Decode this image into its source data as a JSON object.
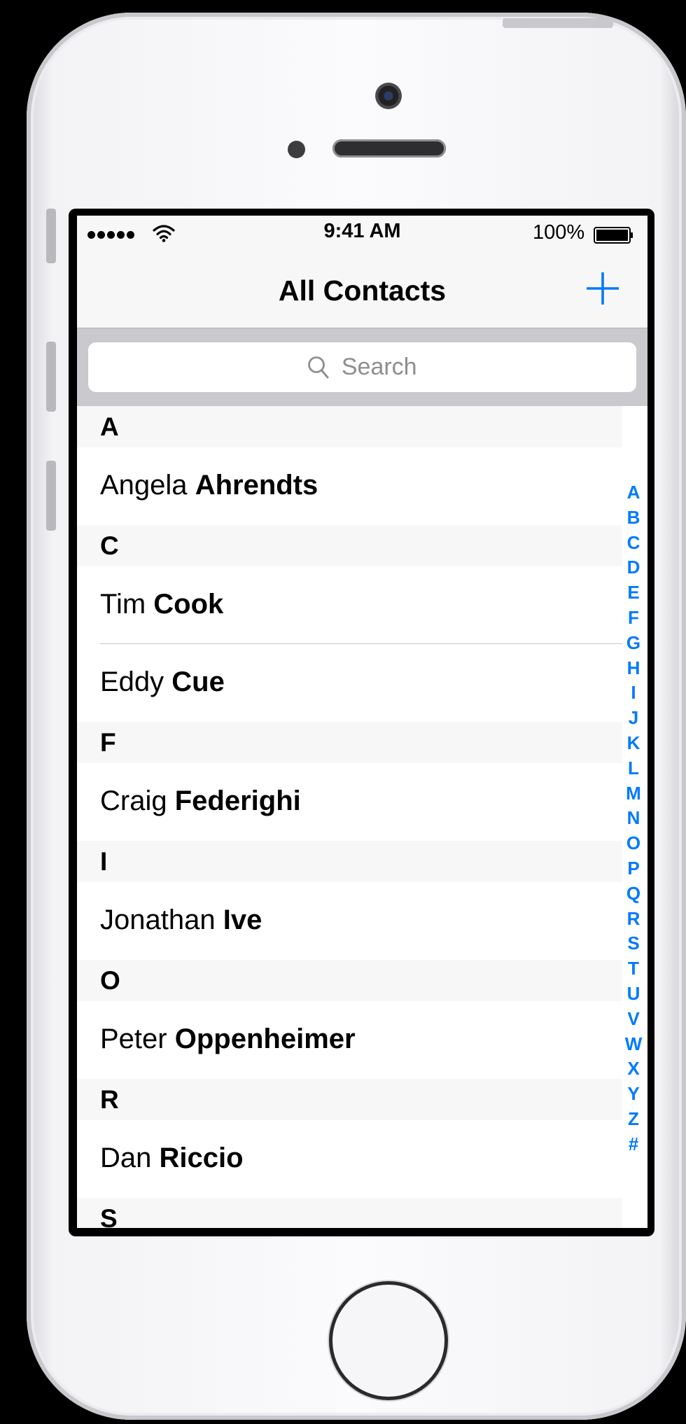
{
  "status_bar": {
    "time": "9:41 AM",
    "battery_percent": "100%",
    "signal_icon": "signal-dots-icon",
    "wifi_icon": "wifi-icon",
    "battery_icon": "battery-icon"
  },
  "nav": {
    "title": "All Contacts",
    "add_icon": "plus-icon"
  },
  "search": {
    "placeholder": "Search",
    "icon": "search-icon"
  },
  "sections": [
    {
      "letter": "A",
      "contacts": [
        {
          "first": "Angela",
          "last": "Ahrendts"
        }
      ]
    },
    {
      "letter": "C",
      "contacts": [
        {
          "first": "Tim",
          "last": "Cook"
        },
        {
          "first": "Eddy",
          "last": "Cue"
        }
      ]
    },
    {
      "letter": "F",
      "contacts": [
        {
          "first": "Craig",
          "last": "Federighi"
        }
      ]
    },
    {
      "letter": "I",
      "contacts": [
        {
          "first": "Jonathan",
          "last": "Ive"
        }
      ]
    },
    {
      "letter": "O",
      "contacts": [
        {
          "first": "Peter",
          "last": "Oppenheimer"
        }
      ]
    },
    {
      "letter": "R",
      "contacts": [
        {
          "first": "Dan",
          "last": "Riccio"
        }
      ]
    },
    {
      "letter": "S",
      "contacts": []
    }
  ],
  "index_letters": [
    "A",
    "B",
    "C",
    "D",
    "E",
    "F",
    "G",
    "H",
    "I",
    "J",
    "K",
    "L",
    "M",
    "N",
    "O",
    "P",
    "Q",
    "R",
    "S",
    "T",
    "U",
    "V",
    "W",
    "X",
    "Y",
    "Z",
    "#"
  ],
  "colors": {
    "accent": "#007aff",
    "bar_background": "#f7f7f7",
    "search_bar_background": "#c9c9ce",
    "section_header_background": "#f7f7f7"
  }
}
